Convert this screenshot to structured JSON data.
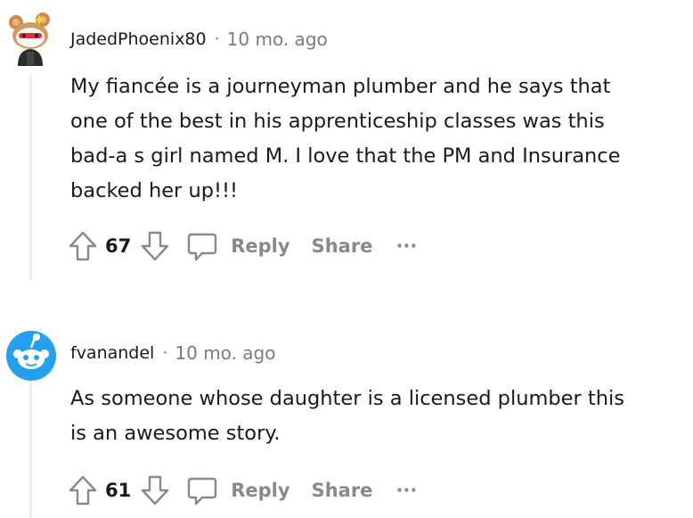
{
  "comments": [
    {
      "username": "JadedPhoenix80",
      "separator": "·",
      "time": "10 mo. ago",
      "body_lines": [
        "My fiancée is a journeyman plumber and he says that",
        "one of the best in his apprenticeship classes was this",
        "bad-a  s girl named M. I love that the PM and Insurance",
        "backed her up!!!"
      ],
      "score": "67",
      "reply_label": "Reply",
      "share_label": "Share",
      "more_label": "···",
      "avatar_icon": "snoo-avatar-icon"
    },
    {
      "username": "fvanandel",
      "separator": "·",
      "time": "10 mo. ago",
      "body_lines": [
        "As someone whose daughter is a licensed plumber this",
        "is an awesome story."
      ],
      "score": "61",
      "reply_label": "Reply",
      "share_label": "Share",
      "more_label": "···",
      "avatar_icon": "snoo-avatar-icon"
    }
  ],
  "colors": {
    "text": "#1a1a1b",
    "muted": "#7c7c7c",
    "action_gray": "#878a8c",
    "thread_line": "#edeff1",
    "avatar_blue": "#24a0ed"
  }
}
